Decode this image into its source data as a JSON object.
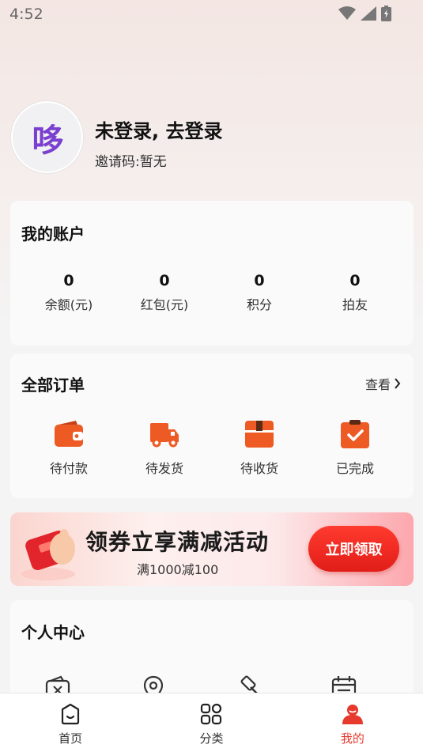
{
  "status_bar": {
    "time": "4:52"
  },
  "profile": {
    "avatar_text": "哆",
    "login_title": "未登录, 去登录",
    "invite_code": "邀请码:暂无"
  },
  "account": {
    "title": "我的账户",
    "stats": [
      {
        "value": "0",
        "label": "余额(元)"
      },
      {
        "value": "0",
        "label": "红包(元)"
      },
      {
        "value": "0",
        "label": "积分"
      },
      {
        "value": "0",
        "label": "拍友"
      }
    ]
  },
  "orders": {
    "title": "全部订单",
    "view_more": "查看",
    "items": [
      {
        "label": "待付款",
        "icon": "wallet-icon"
      },
      {
        "label": "待发货",
        "icon": "truck-icon"
      },
      {
        "label": "待收货",
        "icon": "box-icon"
      },
      {
        "label": "已完成",
        "icon": "clipboard-check-icon"
      }
    ]
  },
  "banner": {
    "title": "领券立享满减活动",
    "subtitle": "满1000减100",
    "button": "立即领取"
  },
  "personal": {
    "title": "个人中心",
    "icons": [
      "wallet-outline-icon",
      "location-icon",
      "auction-hammer-icon",
      "calendar-icon"
    ]
  },
  "tabbar": {
    "items": [
      {
        "label": "首页",
        "icon": "home-icon",
        "active": false
      },
      {
        "label": "分类",
        "icon": "grid-icon",
        "active": false
      },
      {
        "label": "我的",
        "icon": "user-icon",
        "active": true
      }
    ]
  },
  "colors": {
    "accent": "#e53a2d",
    "order_icon": "#ee5a24",
    "avatar_text": "#7a3fcf"
  }
}
